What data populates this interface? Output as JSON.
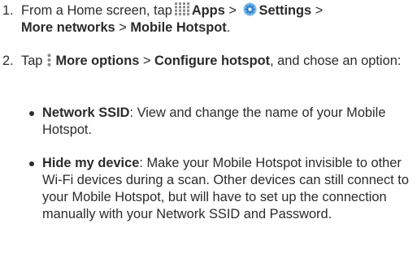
{
  "steps": [
    {
      "number": "1.",
      "line1_pre": "From a Home screen, tap",
      "apps_label": "Apps",
      "sep1": ">",
      "settings_label": "Settings",
      "sep2": ">",
      "more_networks": "More networks",
      "sep3": ">",
      "mobile_hotspot": "Mobile Hotspot",
      "end": "."
    },
    {
      "number": "2.",
      "pre": "Tap",
      "more_options": "More options",
      "sep": ">",
      "configure_hotspot": "Configure hotspot",
      "post": ", and chose an option:"
    }
  ],
  "options": [
    {
      "title": "Network SSID",
      "description": ": View and change the name of your Mobile Hotspot."
    },
    {
      "title": "Hide my device",
      "description": ": Make your Mobile Hotspot invisible to other Wi-Fi devices during a scan. Other devices can still connect to your Mobile Hotspot, but will have to set up the connection manually with your Network SSID and Password."
    }
  ],
  "icons": {
    "apps": "apps-grid-icon",
    "settings": "settings-gear-icon",
    "more_options": "more-options-vertical-dots-icon"
  },
  "colors": {
    "text": "#2b2b2b",
    "icon_gray": "#8a8a8a",
    "settings_blue": "#3d8fd8"
  }
}
